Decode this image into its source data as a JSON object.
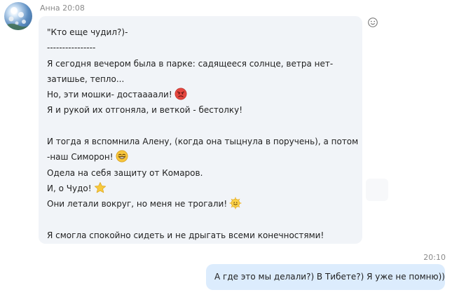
{
  "incoming_message": {
    "sender": "Анна",
    "time": "20:08",
    "avatar_icon": "avatar-photo-icon",
    "lines": [
      {
        "text": "\"Кто еще чудил?)-"
      },
      {
        "text": "----------------"
      },
      {
        "text": "Я сегодня вечером была в парке: садящееся солнце, ветра нет-"
      },
      {
        "text": "затишье, тепло..."
      },
      {
        "text": "Но, эти мошки- достаааали!",
        "emoji": "angry-face-icon"
      },
      {
        "text": "Я и рукой их отгоняла, и веткой - бестолку!"
      },
      {
        "text": ""
      },
      {
        "text": "И тогда я вспомнила Алену, (когда она тыцнула в поручень), а потом"
      },
      {
        "text": "-наш Симорон!",
        "emoji": "laughing-face-icon"
      },
      {
        "text": "Одела на себя защиту от Комаров."
      },
      {
        "text": "И, о Чудо!",
        "emoji": "star-icon"
      },
      {
        "text": "Они летали вокруг, но меня не трогали!",
        "emoji": "sun-smile-icon"
      },
      {
        "text": ""
      },
      {
        "text": "Я смогла спокойно сидеть и не дрыгать всеми конечностями!"
      }
    ],
    "react_icon": "add-reaction-icon"
  },
  "outgoing_message": {
    "time": "20:10",
    "text": "А где это мы делали?) В Тибете?) Я уже не помню))"
  },
  "colors": {
    "incoming_bubble": "#f1f4f8",
    "outgoing_bubble": "#dcecfd",
    "meta_text": "#8a8a8a"
  }
}
